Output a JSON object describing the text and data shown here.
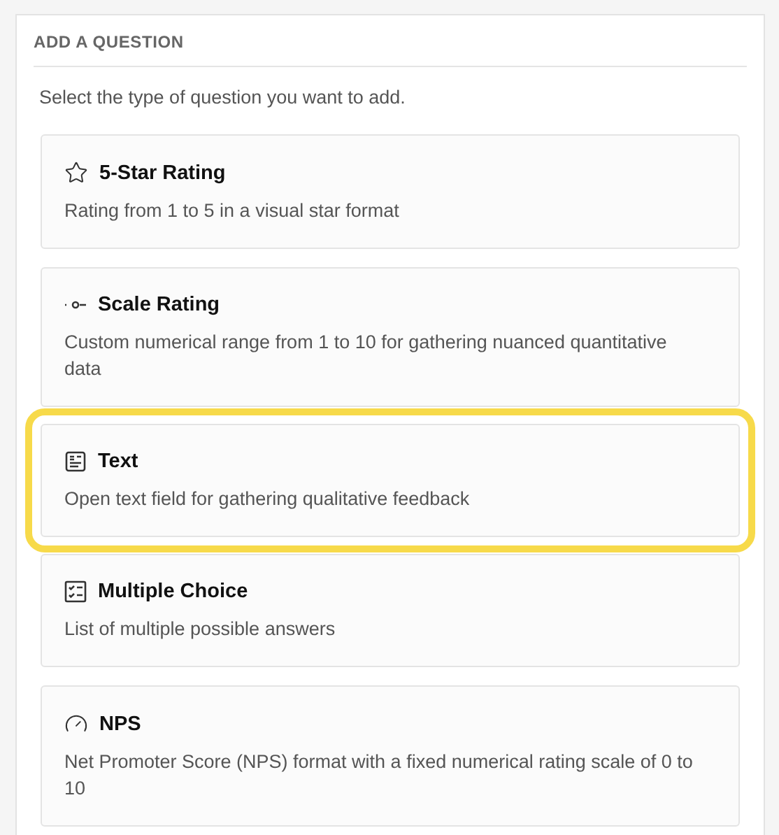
{
  "panel": {
    "title": "ADD A QUESTION",
    "instruction": "Select the type of question you want to add."
  },
  "items": [
    {
      "kind": "star",
      "title": "5-Star Rating",
      "description": "Rating from 1 to 5 in a visual star format",
      "highlighted": false
    },
    {
      "kind": "scale",
      "title": "Scale Rating",
      "description": "Custom numerical range from 1 to 10 for gathering nuanced quantitative data",
      "highlighted": false
    },
    {
      "kind": "text",
      "title": "Text",
      "description": "Open text field for gathering qualitative feedback",
      "highlighted": true
    },
    {
      "kind": "choice",
      "title": "Multiple Choice",
      "description": "List of multiple possible answers",
      "highlighted": false
    },
    {
      "kind": "nps",
      "title": "NPS",
      "description": "Net Promoter Score (NPS) format with a fixed numerical rating scale of 0 to 10",
      "highlighted": false
    }
  ]
}
